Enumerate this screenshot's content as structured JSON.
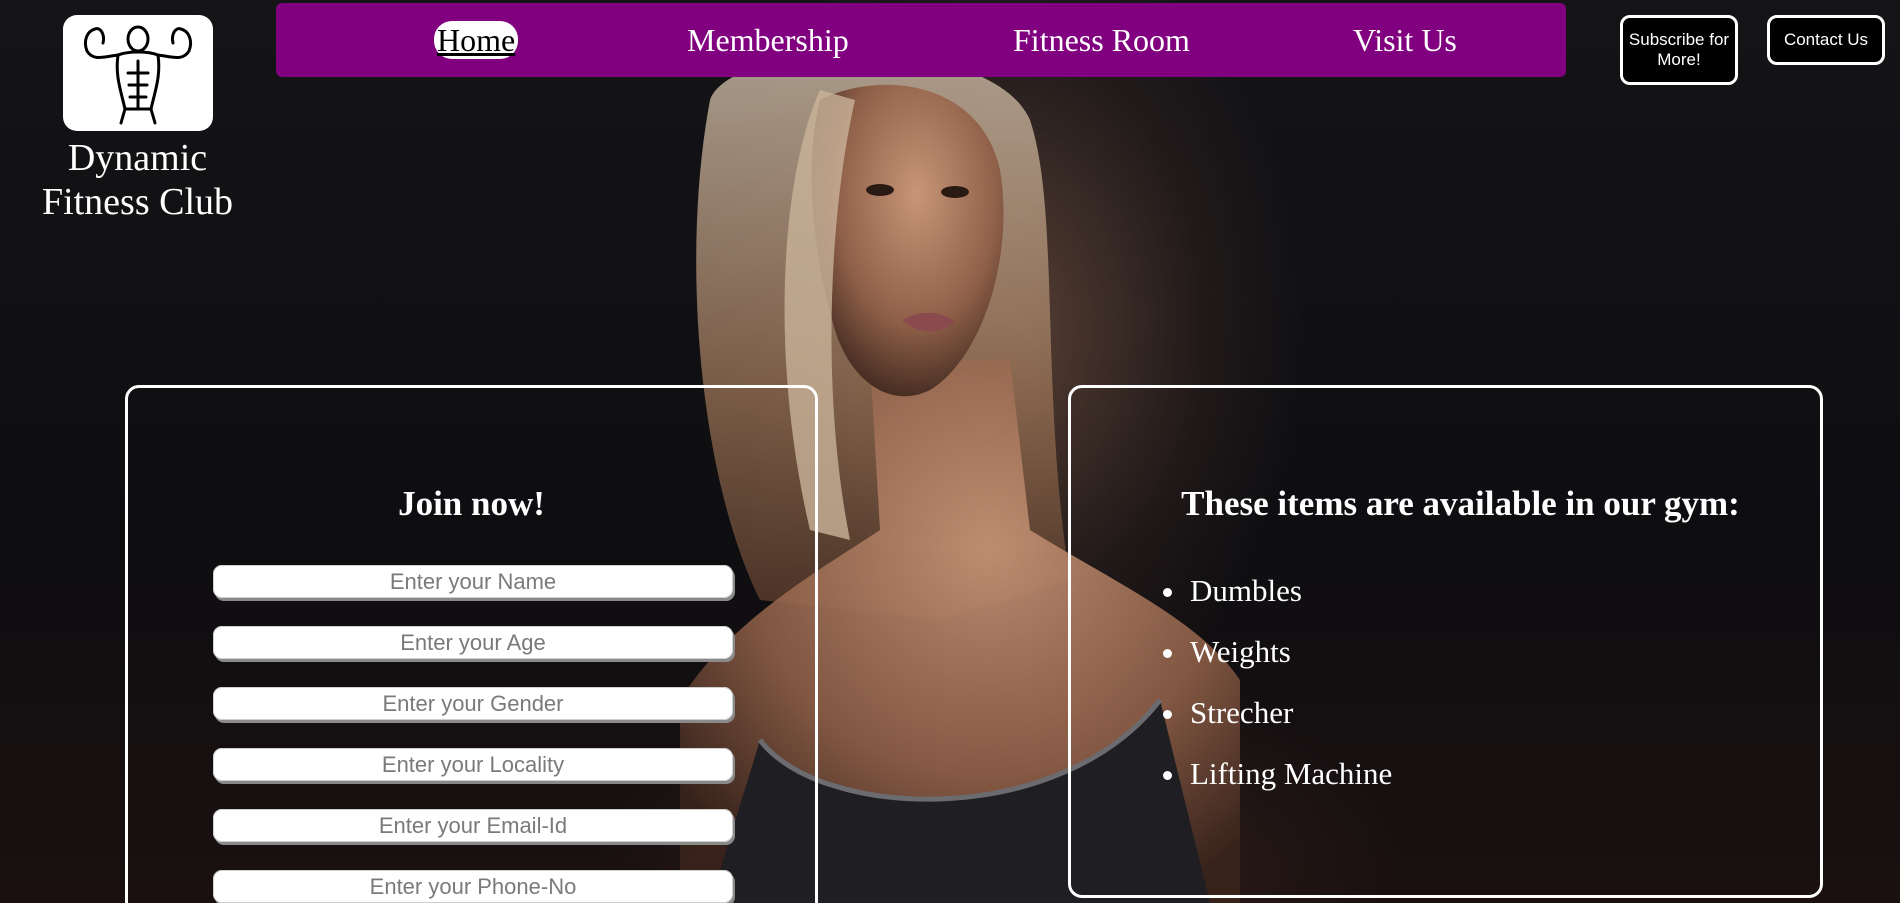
{
  "brand": {
    "name": "Dynamic Fitness Club",
    "logo_icon": "bodybuilder-icon"
  },
  "nav": {
    "items": [
      {
        "label": "Home",
        "active": true
      },
      {
        "label": "Membership",
        "active": false
      },
      {
        "label": "Fitness Room",
        "active": false
      },
      {
        "label": "Visit Us",
        "active": false
      }
    ],
    "background_color": "#800080"
  },
  "actions": {
    "subscribe_label": "Subscribe for More!",
    "contact_label": "Contact Us"
  },
  "join_form": {
    "title": "Join now!",
    "fields": [
      {
        "placeholder": "Enter your Name",
        "value": ""
      },
      {
        "placeholder": "Enter your Age",
        "value": ""
      },
      {
        "placeholder": "Enter your Gender",
        "value": ""
      },
      {
        "placeholder": "Enter your Locality",
        "value": ""
      },
      {
        "placeholder": "Enter your Email-Id",
        "value": ""
      },
      {
        "placeholder": "Enter your Phone-No",
        "value": ""
      }
    ]
  },
  "gym_items": {
    "title": "These items are available in our gym:",
    "items": [
      "Dumbles",
      "Weights",
      "Strecher",
      "Lifting Machine"
    ]
  },
  "colors": {
    "accent": "#800080",
    "text": "#ffffff",
    "background": "#0d0d0f"
  }
}
